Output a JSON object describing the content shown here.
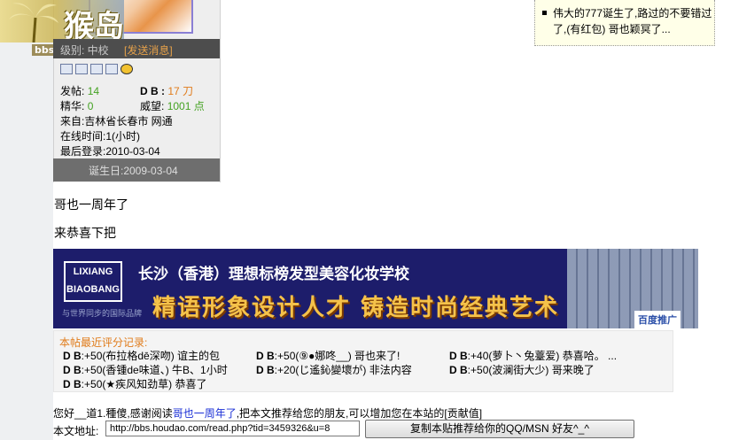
{
  "logo": {
    "text": "猴岛",
    "url": "bbs.houdao.com"
  },
  "profile": {
    "level_label": "级别: 中校",
    "send_message": "[发送消息]",
    "stats": {
      "posts_label": "发帖:",
      "posts_value": "14",
      "db_label": "D B :",
      "db_value": "17 刀",
      "essence_label": "精华:",
      "essence_value": "0",
      "prestige_label": "威望:",
      "prestige_value": "1001 点"
    },
    "origin": "来自:吉林省长春市 网通",
    "online_time": "在线时间:1(小时)",
    "last_login": "最后登录:2010-03-04",
    "birthday": "诞生日:2009-03-04"
  },
  "notice": {
    "text": "伟大的777诞生了,路过的不要错过了,(有红包) 哥也颖冥了..."
  },
  "post": {
    "line1": "哥也一周年了",
    "line2": "来恭喜下把"
  },
  "banner": {
    "logo_line1": "LIXIANG",
    "logo_line2": "BIAOBANG",
    "logo_small": "与世界同步的国际品牌",
    "title": "长沙（香港）理想标榜发型美容化妆学校",
    "slogan": "精语形象设计人才 铸造时尚经典艺术",
    "baidu": "百度推广"
  },
  "ratings": {
    "title": "本帖最近评分记录:",
    "items": [
      {
        "db": "D B",
        "text": ":+50(布拉格dē深吻) 谊主的包"
      },
      {
        "db": "D B",
        "text": ":+50(⑨●娜咚__) 哥也来了!"
      },
      {
        "db": "D B",
        "text": ":+40(萝卜丶兔薹爱) 恭喜哈。"
      },
      {
        "db": "D B",
        "text": ":+50(香锺de味道、) 牛B、1小时"
      },
      {
        "db": "D B",
        "text": ":+20(じ遙鈊變壞が) 非法内容"
      },
      {
        "db": "D B",
        "text": ":+50(波澜街大少) 哥来晚了"
      },
      {
        "db": "D B",
        "text": ":+50(★疾风知劲草) 恭喜了"
      }
    ],
    "more": "..."
  },
  "footer": {
    "prefix": "您好__道1.種傻,感谢阅读",
    "link": "哥也一周年了",
    "suffix": ",把本文推荐给您的朋友,可以增加您在本站的[贡献值]",
    "url_label": "本文地址:",
    "url_value": "http://bbs.houdao.com/read.php?tid=3459326&u=8",
    "copy_button": "复制本贴推荐给你的QQ/MSN 好友^_^"
  }
}
